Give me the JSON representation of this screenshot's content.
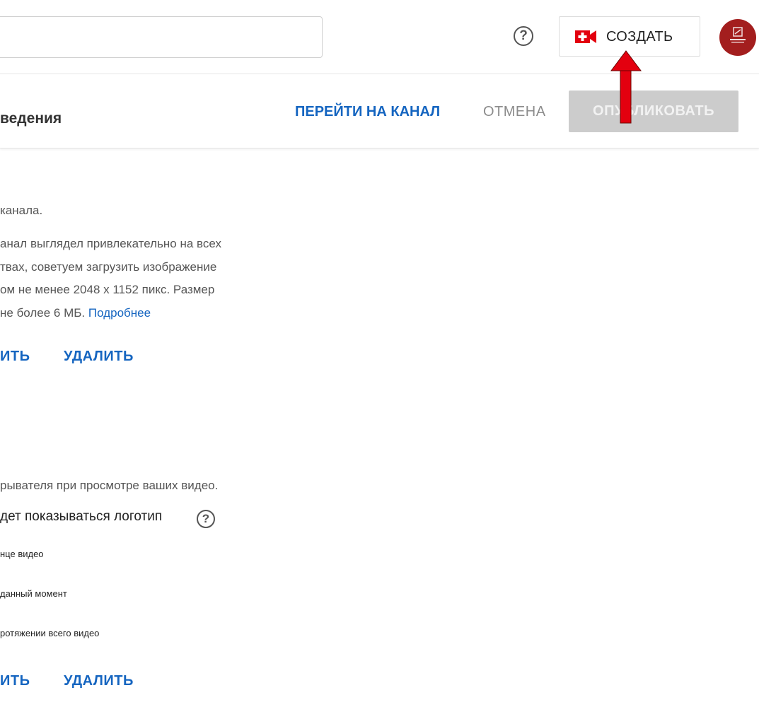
{
  "header": {
    "search": {
      "value": ""
    },
    "help_icon": "?",
    "create_label": "СОЗДАТЬ",
    "avatar_alt": "avatar"
  },
  "subheader": {
    "title": "ведения",
    "goto_channel": "ПЕРЕЙТИ НА КАНАЛ",
    "cancel": "ОТМЕНА",
    "publish": "ОПУБЛИКОВАТЬ"
  },
  "banner_section": {
    "line1": "канала.",
    "line2": "анал выглядел привлекательно на всех",
    "line3": "твах, советуем загрузить изображение",
    "line4": "ом не менее 2048 x 1152 пикс. Размер",
    "line5_text": " не более 6 МБ. ",
    "line5_link": "Подробнее",
    "change": "ИТЬ",
    "delete": "УДАЛИТЬ"
  },
  "watermark_section": {
    "line1": "рывателя при просмотре ваших видео.",
    "display_label": "дет показываться логотип",
    "help_icon": "?",
    "options": [
      "нце видео",
      "данный момент",
      "ротяжении всего видео"
    ],
    "change": "ИТЬ",
    "delete": "УДАЛИТЬ"
  },
  "colors": {
    "accent_blue": "#1565c0",
    "arrow_red": "#e3000f",
    "create_icon_red": "#e3000f",
    "publish_disabled": "#cccccc"
  }
}
